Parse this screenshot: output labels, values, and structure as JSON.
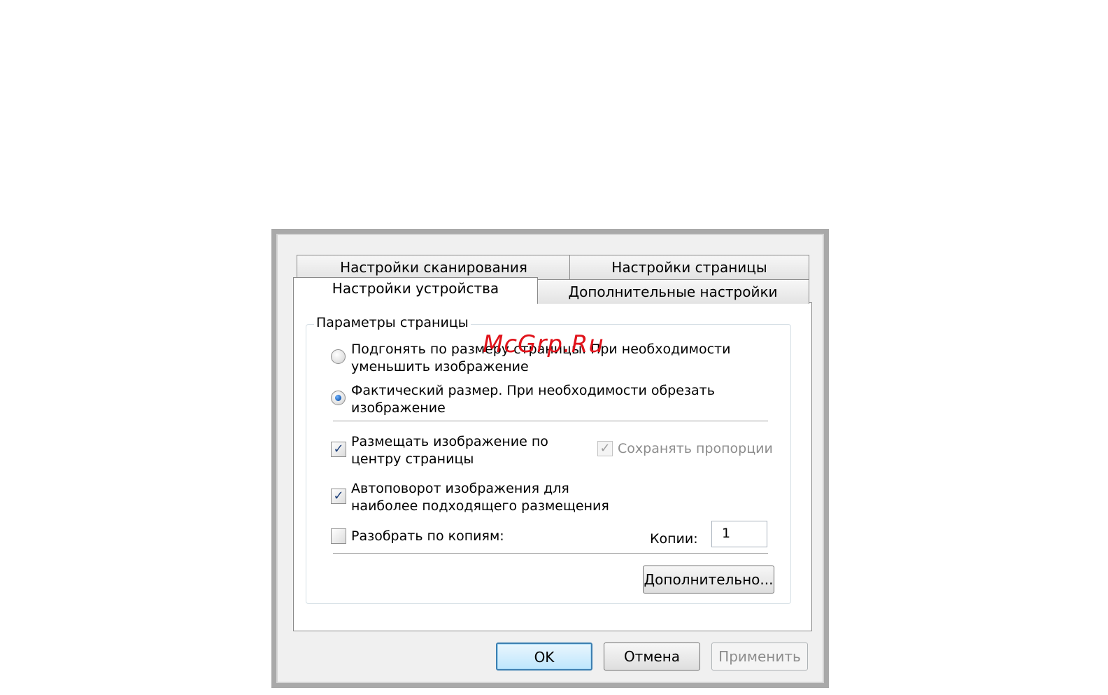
{
  "tabs": {
    "scan": "Настройки сканирования",
    "page": "Настройки страницы",
    "device": "Настройки устройства",
    "advanced": "Дополнительные настройки",
    "active": "device"
  },
  "group": {
    "title": "Параметры страницы",
    "radio_fit_line1": "Подгонять по размеру страницы. При необходимости",
    "radio_fit_line2": "уменьшить изображение",
    "radio_fit_checked": false,
    "radio_actual_line1": "Фактический размер. При необходимости обрезать",
    "radio_actual_line2": "изображение",
    "radio_actual_checked": true,
    "center_line1": "Размещать изображение по",
    "center_line2": "центру страницы",
    "center_checked": true,
    "keep_ratio": "Сохранять пропорции",
    "keep_ratio_checked": true,
    "autorotate_line1": "Автоповорот изображения для",
    "autorotate_line2": "наиболее подходящего размещения",
    "autorotate_checked": true,
    "collate": "Разобрать по копиям:",
    "collate_checked": false,
    "copies_label": "Копии:",
    "copies_value": "1",
    "more_button": "Дополнительно..."
  },
  "buttons": {
    "ok": "OK",
    "cancel": "Отмена",
    "apply": "Применить"
  },
  "watermark": "McGrp.Ru",
  "colors": {
    "accent": "#3c7fb1",
    "watermark": "#e0131b"
  }
}
